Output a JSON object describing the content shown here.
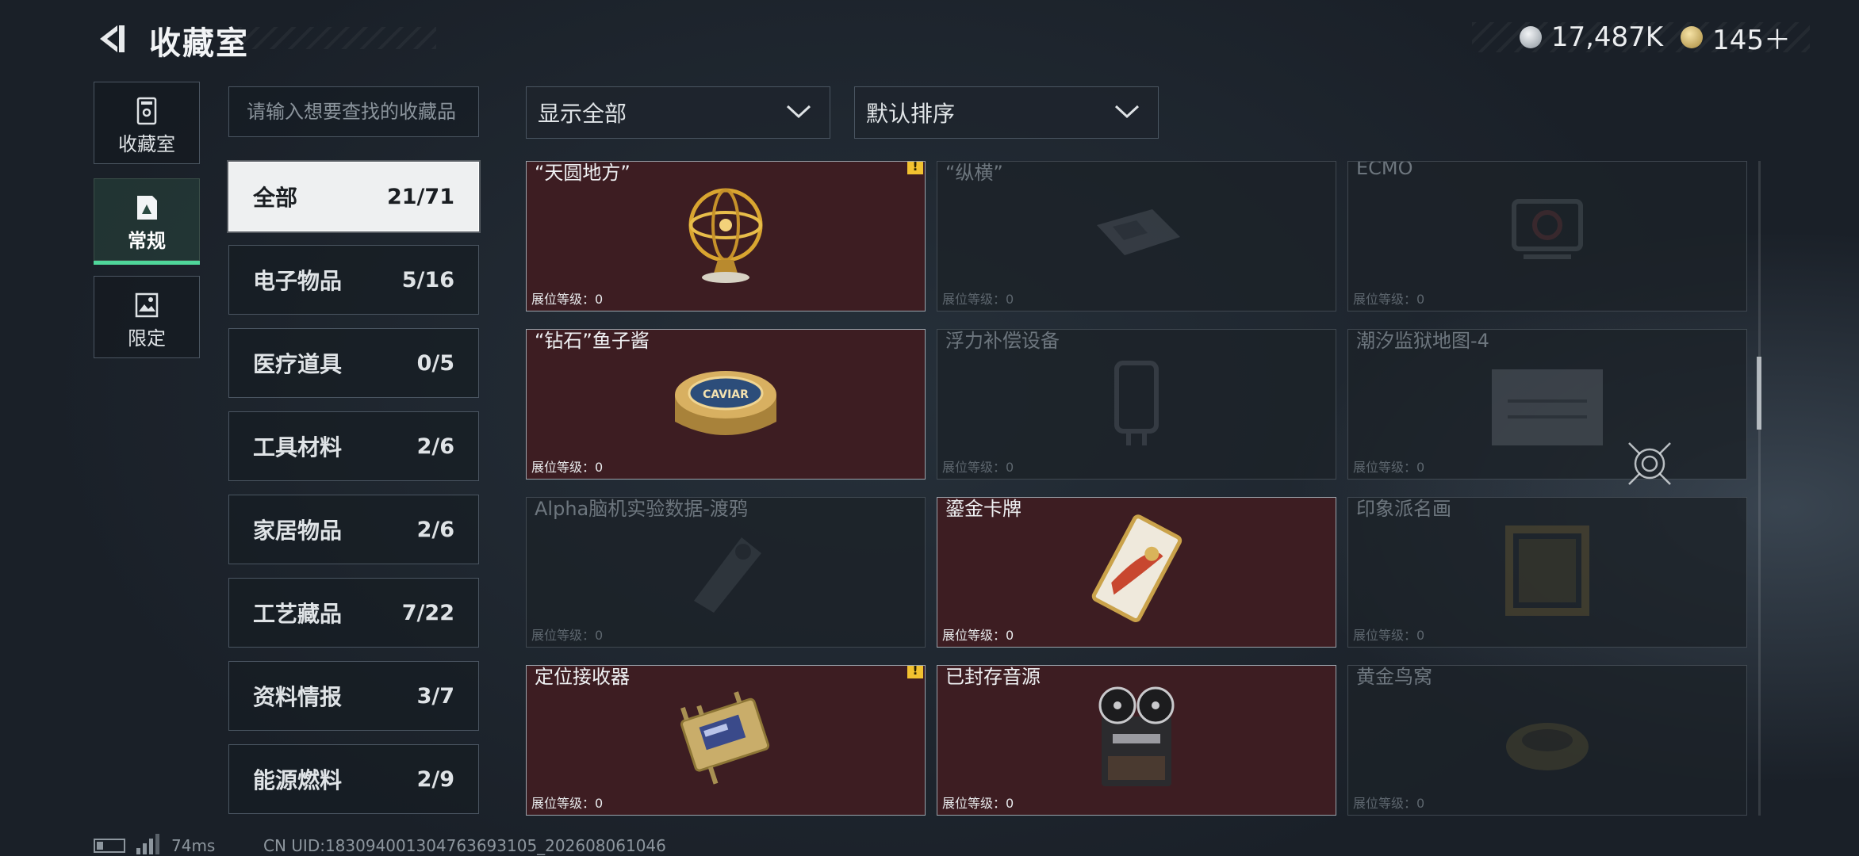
{
  "header": {
    "title": "收藏室"
  },
  "currency": [
    {
      "icon": "silver-coin-icon",
      "value": "17,487K"
    },
    {
      "icon": "gold-coin-icon",
      "value": "145＋"
    }
  ],
  "nav": [
    {
      "label": "收藏室",
      "icon": "vault-icon"
    },
    {
      "label": "常规",
      "icon": "collection-card-icon",
      "active": true
    },
    {
      "label": "限定",
      "icon": "limited-image-icon"
    }
  ],
  "search": {
    "placeholder": "请输入想要查找的收藏品"
  },
  "filter": {
    "value": "显示全部"
  },
  "sort": {
    "value": "默认排序"
  },
  "categories": [
    {
      "label": "全部",
      "count": "21/71",
      "active": true
    },
    {
      "label": "电子物品",
      "count": "5/16"
    },
    {
      "label": "医疗道具",
      "count": "0/5"
    },
    {
      "label": "工具材料",
      "count": "2/6"
    },
    {
      "label": "家居物品",
      "count": "2/6"
    },
    {
      "label": "工艺藏品",
      "count": "7/22"
    },
    {
      "label": "资料情报",
      "count": "3/7"
    },
    {
      "label": "能源燃料",
      "count": "2/9"
    }
  ],
  "items": [
    {
      "name": "“天圆地方”",
      "level": "展位等级：0",
      "owned": true,
      "warning": true,
      "art": "armillary-sphere"
    },
    {
      "name": "“纵横”",
      "level": "展位等级：0",
      "owned": false,
      "art": "chessboard"
    },
    {
      "name": "ECMO",
      "level": "展位等级：0",
      "owned": false,
      "art": "ecmo-machine"
    },
    {
      "name": "“钻石”鱼子酱",
      "level": "展位等级：0",
      "owned": true,
      "art": "caviar-tin",
      "art_text": "CAVIAR"
    },
    {
      "name": "浮力补偿设备",
      "level": "展位等级：0",
      "owned": false,
      "art": "bcd-device"
    },
    {
      "name": "潮汐监狱地图-4",
      "level": "展位等级：0",
      "owned": false,
      "art": "prison-map"
    },
    {
      "name": "Alpha脑机实验数据-渡鸦",
      "level": "展位等级：0",
      "owned": false,
      "art": "data-device"
    },
    {
      "name": "鎏金卡牌",
      "level": "展位等级：0",
      "owned": true,
      "art": "gilded-card"
    },
    {
      "name": "印象派名画",
      "level": "展位等级：0",
      "owned": false,
      "art": "painting"
    },
    {
      "name": "定位接收器",
      "level": "展位等级：0",
      "owned": true,
      "warning": true,
      "art": "locator-receiver"
    },
    {
      "name": "已封存音源",
      "level": "展位等级：0",
      "owned": true,
      "art": "reel-recorder"
    },
    {
      "name": "黄金鸟窝",
      "level": "展位等级：0",
      "owned": false,
      "art": "golden-nest"
    }
  ],
  "footer": {
    "ping": "74ms",
    "uid": "CN UID:183094001304763693105_202608061046"
  },
  "colors": {
    "owned_card": "#3d1d22",
    "accent_green": "#4fd69a",
    "warning": "#f2c230"
  }
}
